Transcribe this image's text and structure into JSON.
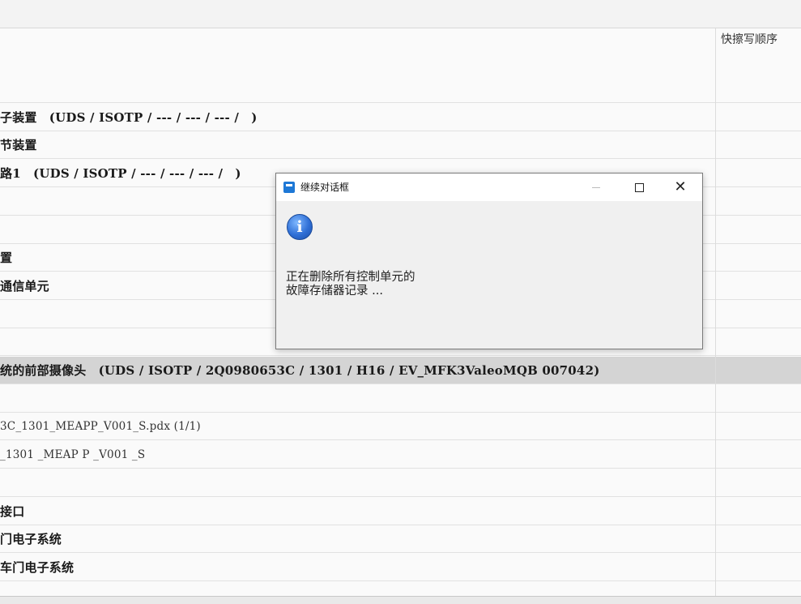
{
  "grid": {
    "column_header": "快擦写顺序",
    "rows": [
      {
        "text": "",
        "light": false
      },
      {
        "text": "子装置　(UDS / ISOTP / --- / --- / --- /　)",
        "light": false
      },
      {
        "text": "节装置",
        "light": false
      },
      {
        "text": "路1　(UDS / ISOTP / --- / --- / --- /　)",
        "light": false
      },
      {
        "text": "",
        "light": false
      },
      {
        "text": "",
        "light": false
      },
      {
        "text": "置",
        "light": false
      },
      {
        "text": "通信单元",
        "light": false
      },
      {
        "text": "",
        "light": false
      },
      {
        "text": "",
        "light": false
      },
      {
        "text": "统的前部摄像头　(UDS / ISOTP / 2Q0980653C / 1301 / H16 / EV_MFK3ValeoMQB 007042)",
        "light": false,
        "selected": true
      },
      {
        "text": "",
        "light": false
      },
      {
        "text": "3C_1301_MEAPP_V001_S.pdx (1/1)",
        "light": true
      },
      {
        "text": "_1301 _MEAP P _V001 _S",
        "light": true
      },
      {
        "text": "",
        "light": false
      },
      {
        "text": "接口",
        "light": false
      },
      {
        "text": "门电子系统",
        "light": false
      },
      {
        "text": "车门电子系统",
        "light": false
      }
    ]
  },
  "dialog": {
    "title": "继续对话框",
    "icon": "info-icon",
    "message_line1": "正在删除所有控制单元的",
    "message_line2": "故障存储器记录 ..."
  }
}
